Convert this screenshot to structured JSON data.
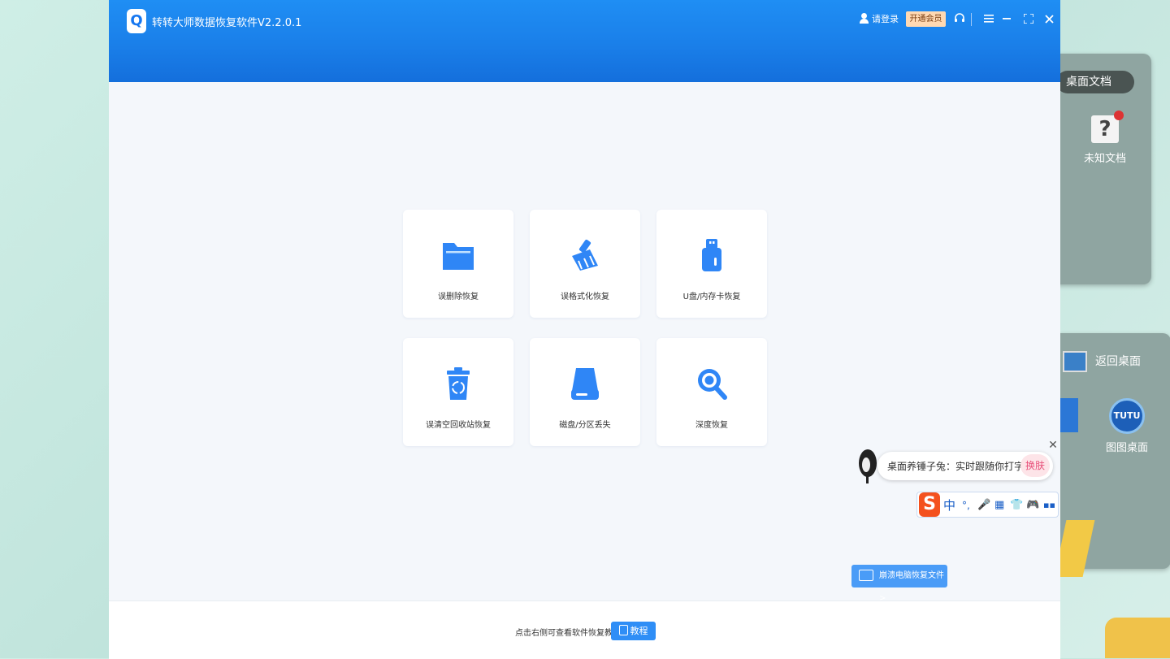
{
  "app": {
    "title": "转转大师数据恢复软件V2.2.0.1",
    "logo_letter": "Q",
    "login_label": "请登录",
    "vip_label": "开通会员"
  },
  "titlebar_icons": [
    "headset-icon",
    "menu-icon",
    "minimize-icon",
    "maximize-icon",
    "close-icon"
  ],
  "recovery_modes": [
    {
      "label": "误删除恢复",
      "icon": "folder-icon"
    },
    {
      "label": "误格式化恢复",
      "icon": "broom-icon"
    },
    {
      "label": "U盘/内存卡恢复",
      "icon": "usb-drive-icon"
    },
    {
      "label": "误清空回收站恢复",
      "icon": "recycle-bin-icon"
    },
    {
      "label": "磁盘/分区丢失",
      "icon": "hard-disk-icon"
    },
    {
      "label": "深度恢复",
      "icon": "magnifier-icon"
    }
  ],
  "footer": {
    "hint": "点击右侧可查看软件恢复教程",
    "tutorial_label": "教程"
  },
  "crash_recovery_label": "崩溃电脑恢复文件 >",
  "ime": {
    "popup_text": "桌面养锤子兔：实时跟随你打字",
    "skin_label": "换肤",
    "logo": "S",
    "items": [
      "中",
      "°,",
      "🎤",
      "▦",
      "👕",
      "🎮",
      "▪▪"
    ]
  },
  "desktop": {
    "folder_tag": "桌面文档",
    "unknown_doc": "未知文档",
    "back_to_desktop": "返回桌面",
    "tutu_desktop": "图图桌面",
    "tutu_logo": "TUTU"
  },
  "colors": {
    "accent": "#1a7fe9",
    "icon_blue": "#2f86f6",
    "vip_bg": "#ffd9b3"
  }
}
